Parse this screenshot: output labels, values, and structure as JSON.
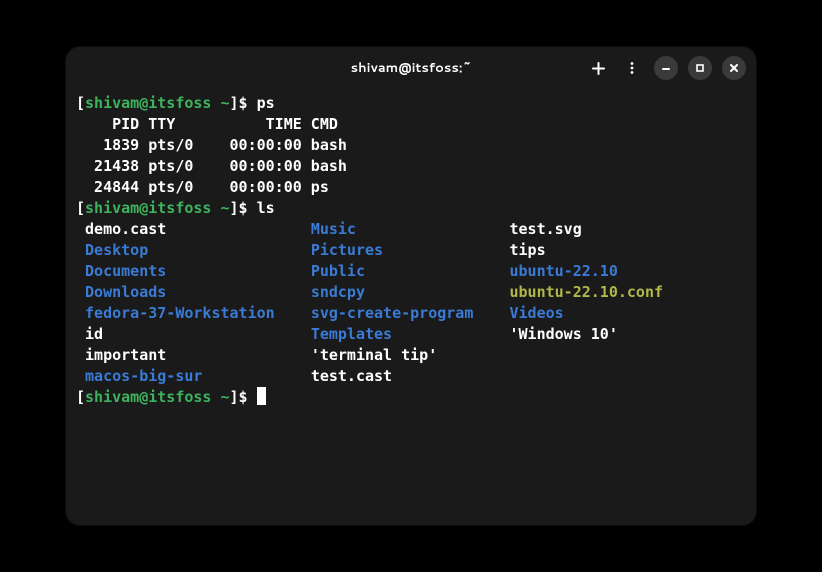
{
  "window": {
    "title": "shivam@itsfoss:~"
  },
  "prompt": {
    "open": "[",
    "user": "shivam@itsfoss",
    "path": " ~",
    "close": "]$ "
  },
  "commands": {
    "ps": "ps",
    "ls": "ls"
  },
  "ps_output": {
    "header": "    PID TTY          TIME CMD",
    "rows": [
      "   1839 pts/0    00:00:00 bash",
      "  21438 pts/0    00:00:00 bash",
      "  24844 pts/0    00:00:00 ps"
    ]
  },
  "ls": {
    "col1": [
      {
        "name": "demo.cast",
        "type": "plain"
      },
      {
        "name": "Desktop",
        "type": "dir"
      },
      {
        "name": "Documents",
        "type": "dir"
      },
      {
        "name": "Downloads",
        "type": "dir"
      },
      {
        "name": "fedora-37-Workstation",
        "type": "dir"
      },
      {
        "name": "id",
        "type": "plain"
      },
      {
        "name": "important",
        "type": "plain"
      },
      {
        "name": "macos-big-sur",
        "type": "dir"
      }
    ],
    "col2": [
      {
        "name": "Music",
        "type": "dir"
      },
      {
        "name": "Pictures",
        "type": "dir"
      },
      {
        "name": "Public",
        "type": "dir"
      },
      {
        "name": "sndcpy",
        "type": "dir"
      },
      {
        "name": "svg-create-program",
        "type": "dir"
      },
      {
        "name": "Templates",
        "type": "dir"
      },
      {
        "name": "'terminal tip'",
        "type": "plain"
      },
      {
        "name": "test.cast",
        "type": "plain"
      }
    ],
    "col3": [
      {
        "name": "test.svg",
        "type": "plain"
      },
      {
        "name": "tips",
        "type": "plain"
      },
      {
        "name": "ubuntu-22.10",
        "type": "dir"
      },
      {
        "name": "ubuntu-22.10.conf",
        "type": "exec"
      },
      {
        "name": "Videos",
        "type": "dir"
      },
      {
        "name": "'Windows 10'",
        "type": "plain"
      }
    ]
  },
  "ls_layout": {
    "col1_width": 25,
    "col2_width": 22
  }
}
